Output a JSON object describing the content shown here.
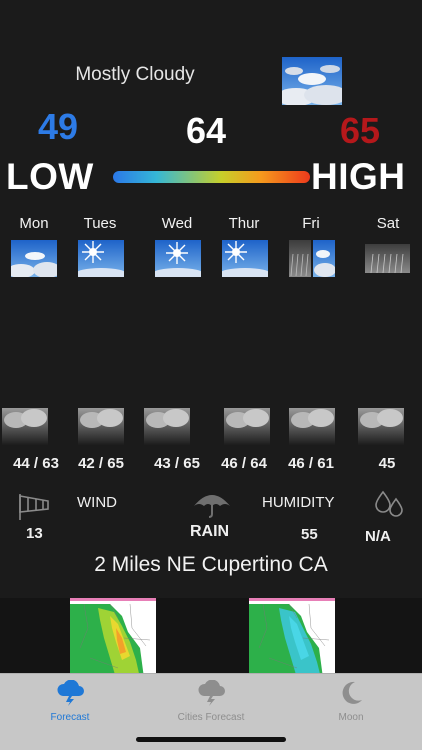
{
  "current": {
    "condition": "Mostly Cloudy",
    "low": "49",
    "temp": "64",
    "high": "65",
    "low_label": "LOW",
    "high_label": "HIGH"
  },
  "days": [
    {
      "name": "Mon",
      "range": "44 / 63"
    },
    {
      "name": "Tues",
      "range": "42 / 65"
    },
    {
      "name": "Wed",
      "range": "43 / 65"
    },
    {
      "name": "Thur",
      "range": "46 / 64"
    },
    {
      "name": "Fri",
      "range": "46 / 61"
    },
    {
      "name": "Sat",
      "range": "45"
    }
  ],
  "stats": {
    "wind_label": "WIND",
    "wind_value": "13",
    "rain_label": "RAIN",
    "humidity_label": "HUMIDITY",
    "humidity_value": "55",
    "precip_value": "N/A"
  },
  "location": "2 Miles NE Cupertino CA",
  "tabs": [
    {
      "label": "Forecast",
      "icon": "storm-cloud-icon",
      "active": true
    },
    {
      "label": "Cities Forecast",
      "icon": "storm-cloud-icon",
      "active": false
    },
    {
      "label": "Moon",
      "icon": "moon-icon",
      "active": false
    }
  ],
  "colors": {
    "low": "#2d7be6",
    "high": "#b5181b",
    "tab_active": "#1f78d6",
    "tab_inactive": "#8e8e8e"
  }
}
